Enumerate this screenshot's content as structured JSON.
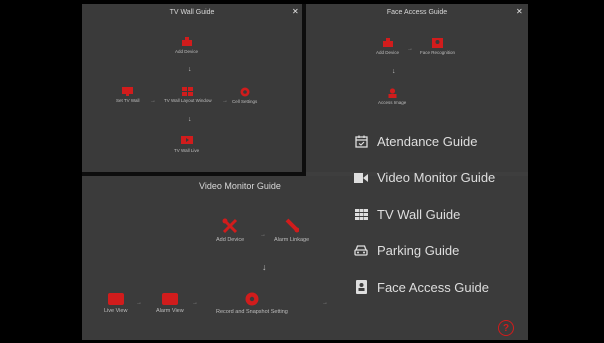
{
  "panels": {
    "tv_wall": {
      "title": "TV Wall Guide",
      "nodes": {
        "add_device": "Add Device",
        "set_tv_wall": "Set TV Wall",
        "tv_wall_layout": "TV Wall Layout Window",
        "cell_settings": "Cell Settings",
        "tv_wall_live": "TV Wall Live"
      }
    },
    "face_access": {
      "title": "Face Access Guide",
      "nodes": {
        "add_device": "Add Device",
        "face_recognition": "Face Recognition",
        "access_image": "Access Image"
      }
    },
    "video_monitor": {
      "title": "Video Monitor Guide",
      "nodes": {
        "add_device": "Add Device",
        "alarm_linkage": "Alarm Linkage",
        "live_view": "Live View",
        "alarm_view": "Alarm View",
        "record_settings": "Record and Snapshot Setting"
      }
    }
  },
  "menu": [
    {
      "label": "Atendance Guide",
      "icon": "calendar-icon"
    },
    {
      "label": "Video Monitor Guide",
      "icon": "video-camera-icon"
    },
    {
      "label": "TV Wall Guide",
      "icon": "grid-icon"
    },
    {
      "label": "Parking Guide",
      "icon": "car-icon"
    },
    {
      "label": "Face Access Guide",
      "icon": "id-badge-icon"
    }
  ],
  "colors": {
    "accent": "#d11c1c",
    "background": "#000000",
    "panel": "#3a3a3a"
  },
  "help_label": "?"
}
